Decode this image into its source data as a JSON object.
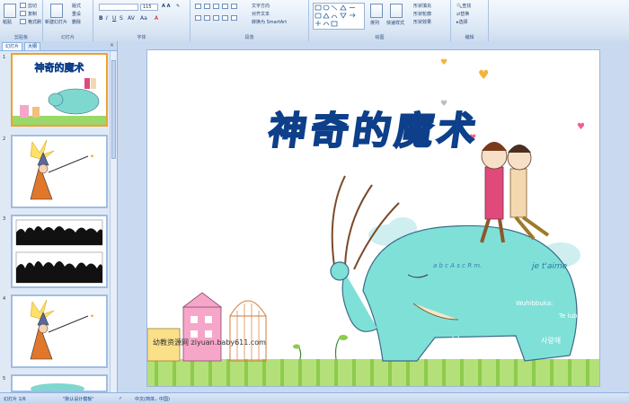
{
  "ribbon": {
    "clipboard": {
      "paste": "粘贴",
      "cut": "剪切",
      "copy": "复制",
      "format_painter": "格式刷",
      "label": "剪贴板"
    },
    "slides": {
      "new_slide": "新建幻灯片",
      "layout": "版式",
      "reset": "重设",
      "delete": "删除",
      "label": "幻灯片"
    },
    "font": {
      "size": "115",
      "label": "字体"
    },
    "paragraph": {
      "text_direction": "文字方向",
      "align_text": "对齐文本",
      "smartart": "转换为 SmartArt",
      "label": "段落"
    },
    "drawing": {
      "arrange": "排列",
      "quick_styles": "快速样式",
      "fill": "形状填充",
      "outline": "形状轮廓",
      "effects": "形状效果",
      "label": "绘图"
    },
    "editing": {
      "find": "查找",
      "replace": "替换",
      "select": "选择",
      "label": "编辑"
    }
  },
  "panel": {
    "tab_slides": "幻灯片",
    "tab_outline": "大纲",
    "close": "×",
    "slides": [
      {
        "num": "1",
        "title": "神奇的魔术"
      },
      {
        "num": "2"
      },
      {
        "num": "3"
      },
      {
        "num": "4"
      },
      {
        "num": "5"
      }
    ]
  },
  "slide": {
    "title": "神奇的魔术",
    "texts": {
      "abc": "a b c  A s c R m.",
      "love": "I love you",
      "korean": "사랑해",
      "wuhi": "Wuhibbuka:",
      "teiu": "Te iubesc",
      "jet": "je t'aime"
    },
    "watermark": "幼教资源网 ziyuan.baby611.com"
  },
  "status": {
    "slide_info": "幻灯片 1/6",
    "theme": "\"默认设计模板\"",
    "lang": "中文(简体，中国)"
  }
}
